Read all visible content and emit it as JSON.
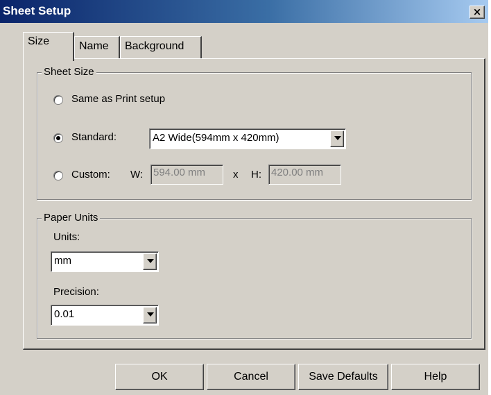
{
  "window": {
    "title": "Sheet Setup",
    "close_label": "×"
  },
  "tabs": [
    {
      "label": "Size",
      "active": true
    },
    {
      "label": "Name",
      "active": false
    },
    {
      "label": "Background",
      "active": false
    }
  ],
  "sheet_size": {
    "group_title": "Sheet Size",
    "same_as_print": {
      "label": "Same as Print setup",
      "checked": false
    },
    "standard": {
      "label": "Standard:",
      "checked": true,
      "selected": "A2 Wide(594mm x 420mm)"
    },
    "custom": {
      "label": "Custom:",
      "checked": false,
      "w_label": "W:",
      "w_value": "594.00 mm",
      "x_label": "x",
      "h_label": "H:",
      "h_value": "420.00 mm"
    }
  },
  "paper_units": {
    "group_title": "Paper Units",
    "units_label": "Units:",
    "units_value": "mm",
    "precision_label": "Precision:",
    "precision_value": "0.01"
  },
  "buttons": {
    "ok": "OK",
    "cancel": "Cancel",
    "save_defaults": "Save Defaults",
    "help": "Help"
  },
  "colors": {
    "title_bar_start": "#0a246a",
    "title_bar_end": "#a6caf0",
    "face": "#d4d0c8"
  }
}
